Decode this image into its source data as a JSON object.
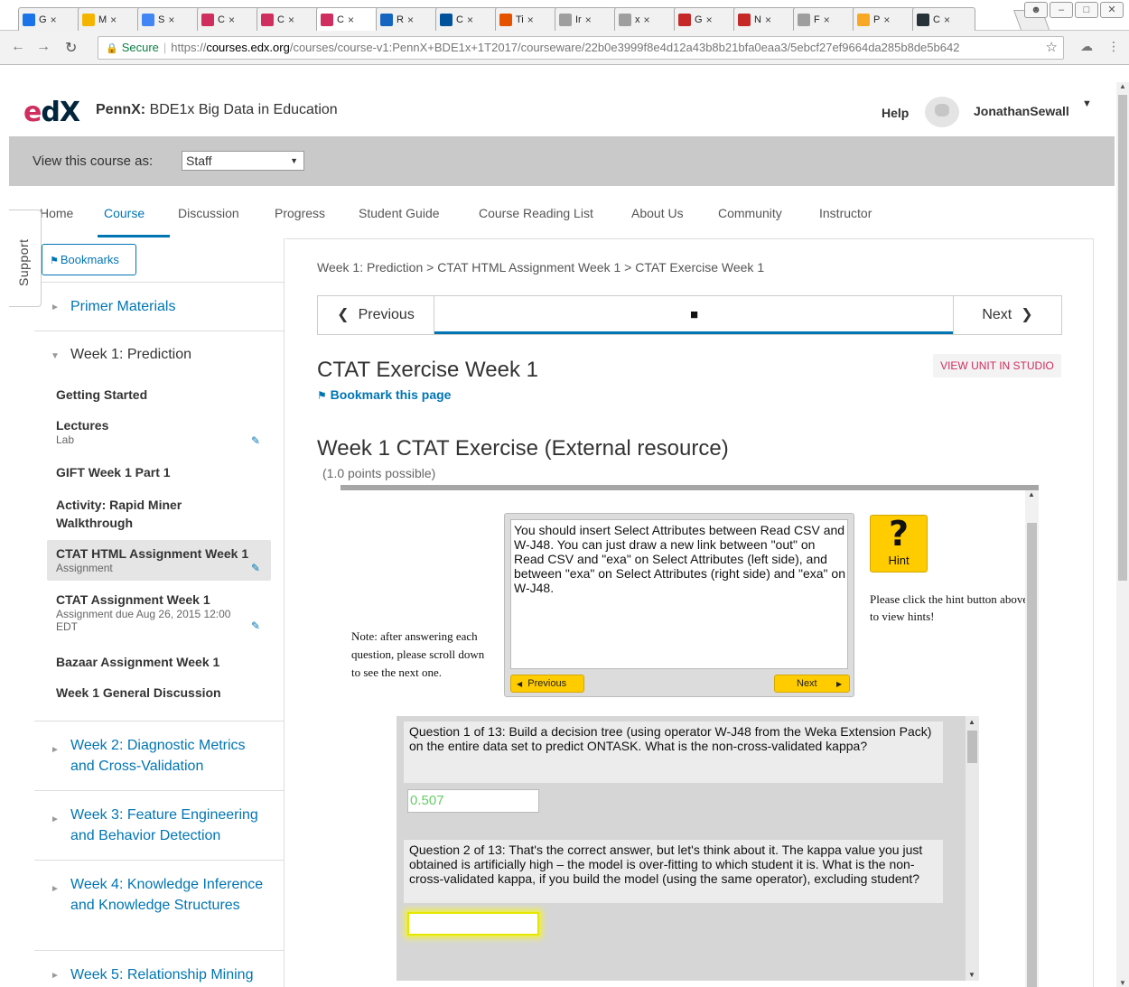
{
  "browser": {
    "tabs": [
      {
        "abbr": "G",
        "icon": "calendar-icon",
        "color": "#1a73e8"
      },
      {
        "abbr": "M",
        "icon": "drive-icon",
        "color": "#f4b400"
      },
      {
        "abbr": "S",
        "icon": "docs-icon",
        "color": "#4285f4"
      },
      {
        "abbr": "C",
        "icon": "edx-icon",
        "color": "#cf2e5e"
      },
      {
        "abbr": "C",
        "icon": "edx-icon",
        "color": "#cf2e5e"
      },
      {
        "abbr": "C",
        "icon": "edx-icon",
        "color": "#cf2e5e"
      },
      {
        "abbr": "R",
        "icon": "monitor-icon",
        "color": "#1565c0"
      },
      {
        "abbr": "C",
        "icon": "c-icon",
        "color": "#00539b"
      },
      {
        "abbr": "Ti",
        "icon": "flower-icon",
        "color": "#e65100"
      },
      {
        "abbr": "Ir",
        "icon": "page-icon",
        "color": "#9e9e9e"
      },
      {
        "abbr": "x",
        "icon": "page-icon",
        "color": "#9e9e9e"
      },
      {
        "abbr": "G",
        "icon": "github-icon",
        "color": "#c62828"
      },
      {
        "abbr": "N",
        "icon": "arc-icon",
        "color": "#c62828"
      },
      {
        "abbr": "F",
        "icon": "page-icon",
        "color": "#9e9e9e"
      },
      {
        "abbr": "P",
        "icon": "ts-icon",
        "color": "#f9a825"
      },
      {
        "abbr": "C",
        "icon": "c-icon",
        "color": "#263238"
      }
    ],
    "url_secure": "Secure",
    "url_scheme": "https://",
    "url_host": "courses.edx.org",
    "url_path": "/courses/course-v1:PennX+BDE1x+1T2017/courseware/22b0e3999f8e4d12a43b8b21bfa0eaa3/5ebcf27ef9664da285b8de5b642"
  },
  "header": {
    "logo": "edX",
    "course_org": "PennX:",
    "course_name": "BDE1x Big Data in Education",
    "help": "Help",
    "username": "JonathanSewall"
  },
  "view_as": {
    "label": "View this course as:",
    "selected": "Staff"
  },
  "course_nav": [
    "Home",
    "Course",
    "Discussion",
    "Progress",
    "Student Guide",
    "Course Reading List",
    "About Us",
    "Community",
    "Instructor"
  ],
  "support": "Support",
  "sidebar": {
    "bookmarks": "Bookmarks",
    "chapters": [
      {
        "title": "Primer Materials"
      },
      {
        "title": "Week 1: Prediction"
      },
      {
        "title": "Week 2: Diagnostic Metrics and Cross-Validation"
      },
      {
        "title": "Week 3: Feature Engineering and Behavior Detection"
      },
      {
        "title": "Week 4: Knowledge Inference and Knowledge Structures"
      },
      {
        "title": "Week 5: Relationship Mining"
      }
    ],
    "sequences": [
      {
        "title": "Getting Started",
        "sub": ""
      },
      {
        "title": "Lectures",
        "sub": "Lab"
      },
      {
        "title": "GIFT Week 1 Part 1",
        "sub": ""
      },
      {
        "title": "Activity: Rapid Miner Walkthrough",
        "sub": ""
      },
      {
        "title": "CTAT HTML Assignment Week 1",
        "sub": "Assignment"
      },
      {
        "title": "CTAT Assignment Week 1",
        "sub": "Assignment due Aug 26, 2015 12:00 EDT"
      },
      {
        "title": "Bazaar Assignment Week 1",
        "sub": ""
      },
      {
        "title": "Week 1 General Discussion",
        "sub": ""
      }
    ]
  },
  "main": {
    "breadcrumb": "Week 1: Prediction > CTAT HTML Assignment Week 1 > CTAT Exercise Week 1",
    "previous": "Previous",
    "next": "Next",
    "unit_title": "CTAT Exercise Week 1",
    "studio": "VIEW UNIT IN STUDIO",
    "bookmark_page": "Bookmark this page",
    "problem_title": "Week 1 CTAT Exercise (External resource)",
    "points": "(1.0 points possible)"
  },
  "tutor": {
    "hint_text": "You should insert Select Attributes between Read CSV and W-J48. You can just draw a new link between \"out\" on Read CSV and \"exa\" on Select Attributes (left side), and between \"exa\" on Select Attributes (right side) and \"exa\" on W-J48.",
    "hint_prev": "Previous",
    "hint_next": "Next",
    "hint_button": "Hint",
    "hint_note": "Please click the hint button above to view hints!",
    "scroll_note": "Note: after answering each question, please scroll down to see the next one.",
    "q1": "Question 1 of 13: Build a decision tree (using operator W-J48 from the Weka Extension Pack) on the entire data set to predict ONTASK. What is the non-cross-validated kappa?",
    "a1": "0.507",
    "q2": "Question 2 of 13: That's the correct answer, but let's think about it. The kappa value you just obtained is artificially high – the model is over-fitting to which student it is. What is the non-cross-validated kappa, if you build the model (using the same operator), excluding student?",
    "a2": ""
  }
}
